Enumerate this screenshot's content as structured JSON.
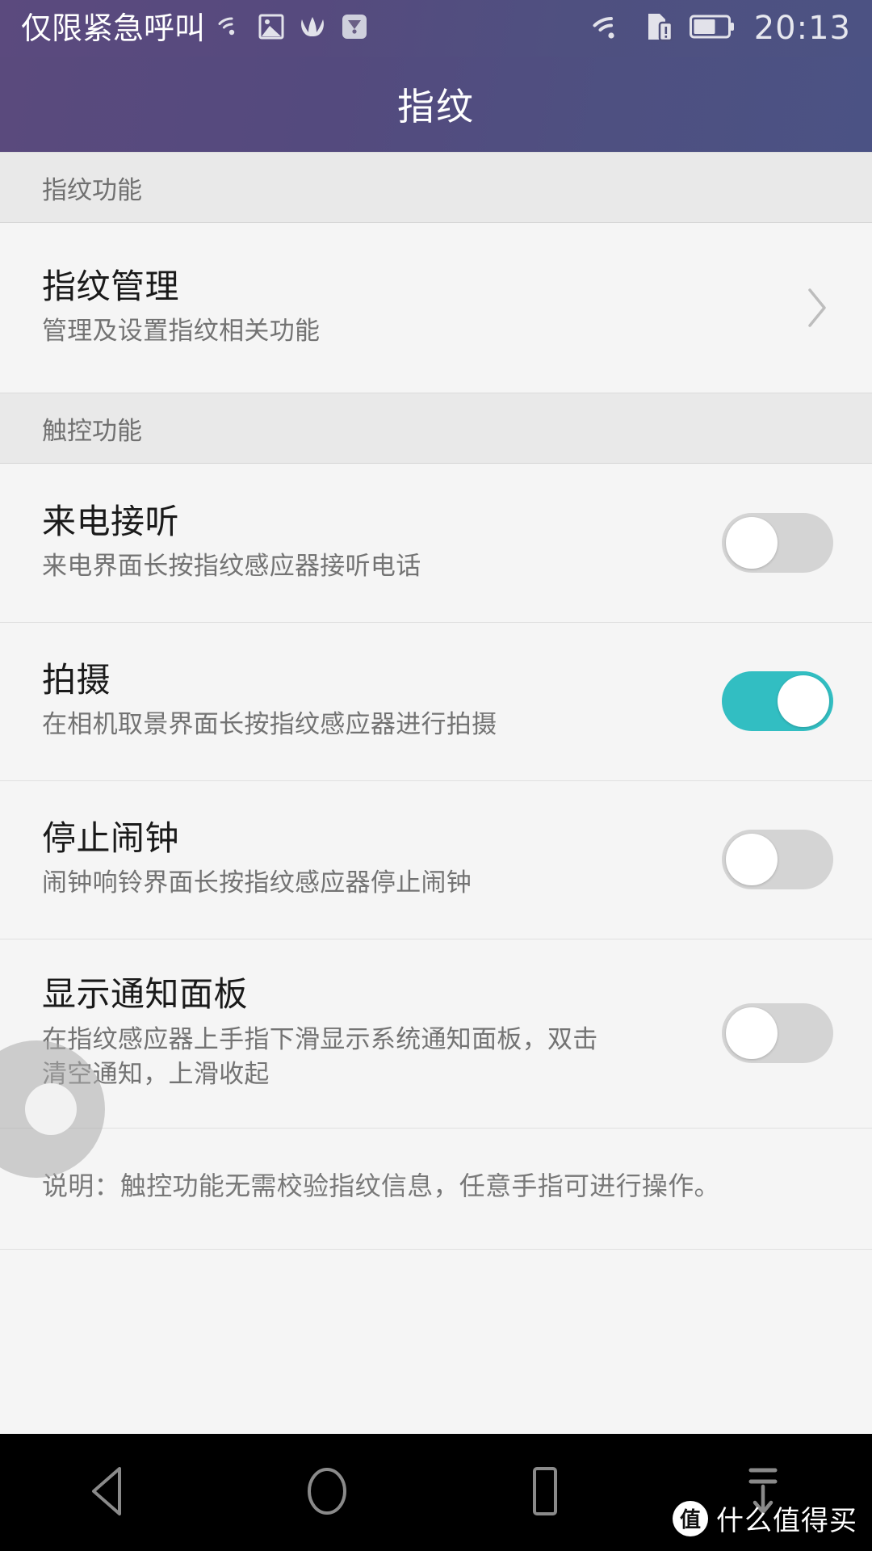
{
  "statusbar": {
    "carrier": "仅限紧急呼叫",
    "clock": "20:13",
    "left_icons": [
      "wifi-signal-icon",
      "gallery-icon",
      "huawei-logo-icon",
      "app-icon"
    ],
    "right_icons": [
      "wifi-icon",
      "sim-alert-icon",
      "battery-icon"
    ]
  },
  "header": {
    "title": "指纹"
  },
  "sections": [
    {
      "header": "指纹功能",
      "rows": [
        {
          "title": "指纹管理",
          "subtitle": "管理及设置指纹相关功能",
          "control": "chevron"
        }
      ]
    },
    {
      "header": "触控功能",
      "rows": [
        {
          "title": "来电接听",
          "subtitle": "来电界面长按指纹感应器接听电话",
          "control": "switch",
          "state": "off"
        },
        {
          "title": "拍摄",
          "subtitle": "在相机取景界面长按指纹感应器进行拍摄",
          "control": "switch",
          "state": "on"
        },
        {
          "title": "停止闹钟",
          "subtitle": "闹钟响铃界面长按指纹感应器停止闹钟",
          "control": "switch",
          "state": "off"
        },
        {
          "title": "显示通知面板",
          "subtitle": "在指纹感应器上手指下滑显示系统通知面板，双击清空通知，上滑收起",
          "control": "switch",
          "state": "off"
        }
      ]
    }
  ],
  "footnote": "说明：触控功能无需校验指纹信息，任意手指可进行操作。",
  "navbar": {
    "back_icon": "back-triangle-icon",
    "home_icon": "home-circle-icon",
    "recents_icon": "recents-square-icon",
    "pulldown_icon": "notification-pulldown-icon"
  },
  "watermark": {
    "badge": "值",
    "text": "什么值得买"
  },
  "colors": {
    "header_gradient_start": "#5b4a7e",
    "header_gradient_end": "#4c5283",
    "switch_on": "#32bec2",
    "switch_off": "#d4d4d4",
    "page_bg": "#f5f5f5",
    "section_bg": "#e9e9e9"
  }
}
